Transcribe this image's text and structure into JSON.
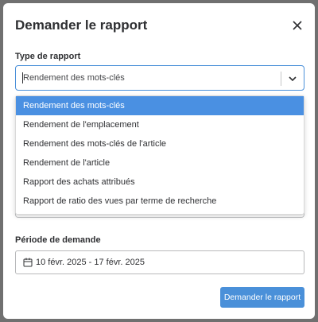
{
  "modal": {
    "title": "Demander le rapport",
    "close_icon": "close-icon"
  },
  "report_type": {
    "label": "Type de rapport",
    "selected": "Rendement des mots-clés",
    "options": [
      "Rendement des mots-clés",
      "Rendement de l'emplacement",
      "Rendement des mots-clés de l'article",
      "Rendement de l'article",
      "Rapport des achats attribués",
      "Rapport de ratio des vues par terme de recherche"
    ]
  },
  "period": {
    "label": "Période de demande",
    "value": "10 févr. 2025 - 17 févr. 2025",
    "icon": "calendar-icon"
  },
  "actions": {
    "submit_label": "Demander le rapport"
  },
  "colors": {
    "accent": "#4a90d9",
    "selected_option": "#4a90e2",
    "backdrop": "#6b6b6b"
  }
}
